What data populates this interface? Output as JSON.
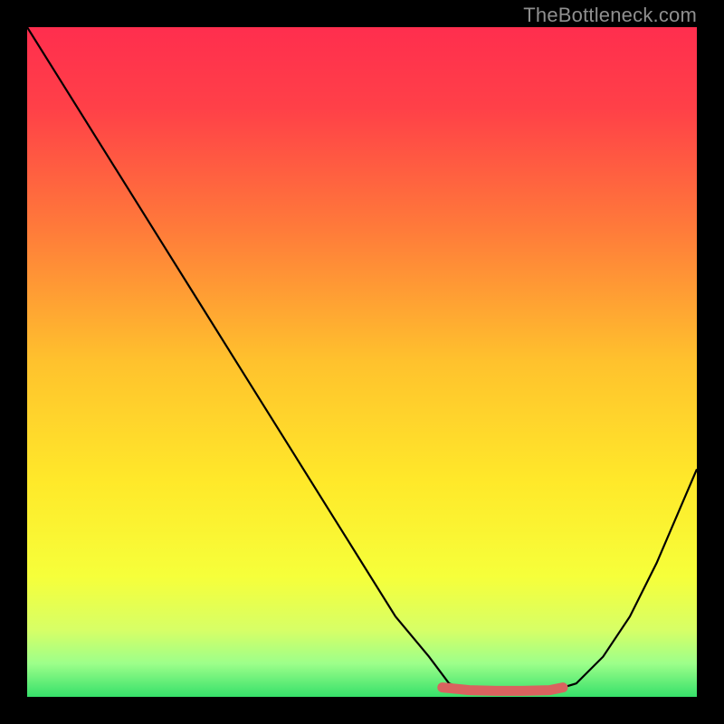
{
  "watermark": "TheBottleneck.com",
  "chart_data": {
    "type": "line",
    "title": "",
    "xlabel": "",
    "ylabel": "",
    "xlim": [
      0,
      100
    ],
    "ylim": [
      0,
      100
    ],
    "x": [
      0,
      5,
      10,
      15,
      20,
      25,
      30,
      35,
      40,
      45,
      50,
      55,
      60,
      63,
      66,
      70,
      74,
      78,
      82,
      86,
      90,
      94,
      100
    ],
    "values": [
      100,
      92,
      84,
      76,
      68,
      60,
      52,
      44,
      36,
      28,
      20,
      12,
      6,
      2,
      0.8,
      0.5,
      0.5,
      0.8,
      2,
      6,
      12,
      20,
      34
    ],
    "series": [
      {
        "name": "bottleneck-curve",
        "x": [
          0,
          5,
          10,
          15,
          20,
          25,
          30,
          35,
          40,
          45,
          50,
          55,
          60,
          63,
          66,
          70,
          74,
          78,
          82,
          86,
          90,
          94,
          100
        ],
        "values": [
          100,
          92,
          84,
          76,
          68,
          60,
          52,
          44,
          36,
          28,
          20,
          12,
          6,
          2,
          0.8,
          0.5,
          0.5,
          0.8,
          2,
          6,
          12,
          20,
          34
        ],
        "color": "#000000"
      },
      {
        "name": "optimal-region",
        "x": [
          62,
          66,
          70,
          74,
          78,
          80
        ],
        "values": [
          1.4,
          1.0,
          0.9,
          0.9,
          1.0,
          1.4
        ],
        "color": "#d9635f"
      }
    ],
    "gradient_stops": [
      {
        "pos": 0.0,
        "color": "#ff2e4e"
      },
      {
        "pos": 0.12,
        "color": "#ff4048"
      },
      {
        "pos": 0.3,
        "color": "#ff7a3a"
      },
      {
        "pos": 0.5,
        "color": "#ffc22d"
      },
      {
        "pos": 0.68,
        "color": "#ffe92a"
      },
      {
        "pos": 0.82,
        "color": "#f6ff3a"
      },
      {
        "pos": 0.9,
        "color": "#d7ff66"
      },
      {
        "pos": 0.95,
        "color": "#9dff8a"
      },
      {
        "pos": 1.0,
        "color": "#36e06a"
      }
    ]
  }
}
